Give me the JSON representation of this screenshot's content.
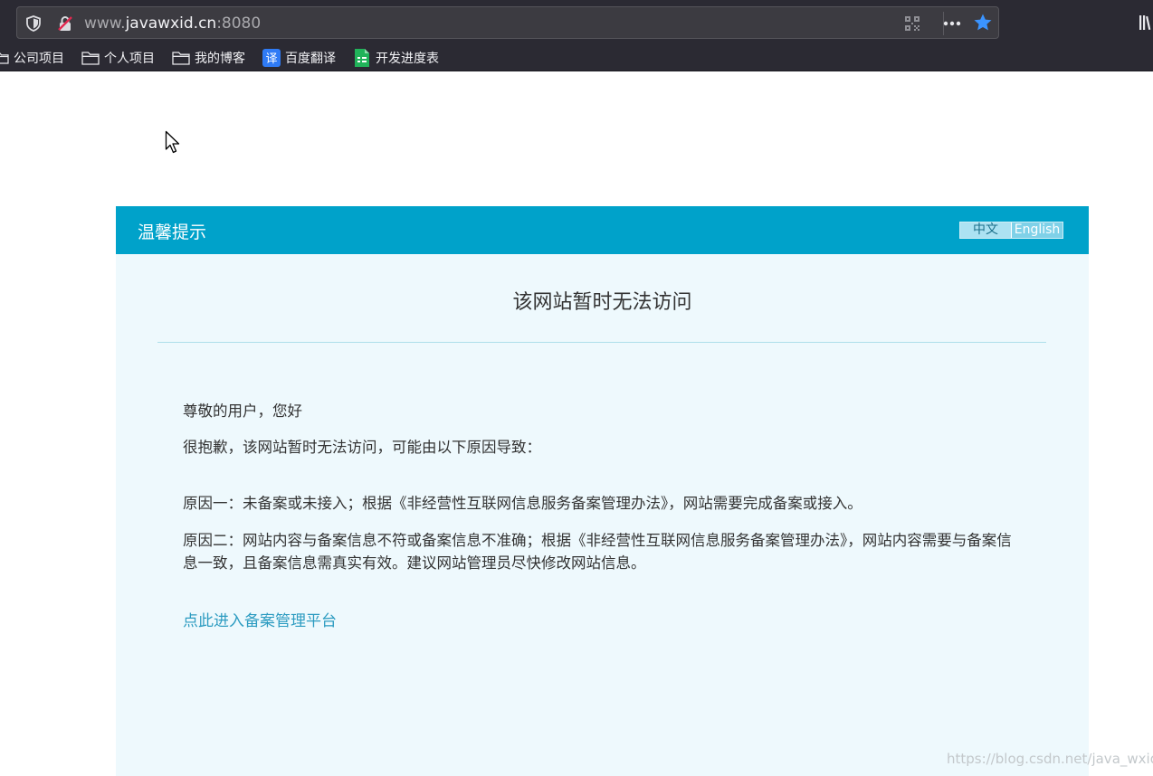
{
  "browser": {
    "url_prefix": "www.",
    "url_domain": "javawxid.cn",
    "url_port": ":8080",
    "icons": [
      "shield-icon",
      "insecure-lock-icon",
      "qr-code-icon",
      "page-actions-icon",
      "bookmark-star-icon",
      "library-icon"
    ],
    "colors": {
      "star": "#3b94ff",
      "toolbar": "#2b2a33"
    }
  },
  "bookmarks": [
    {
      "label": "公司项目",
      "icon": "folder-icon"
    },
    {
      "label": "个人项目",
      "icon": "folder-icon"
    },
    {
      "label": "我的博客",
      "icon": "folder-icon"
    },
    {
      "label": "百度翻译",
      "icon": "baidu-translate-icon",
      "icon_text": "译"
    },
    {
      "label": "开发进度表",
      "icon": "spreadsheet-icon"
    }
  ],
  "notice": {
    "header_title": "温馨提示",
    "lang_zh": "中文",
    "lang_en": "English",
    "title": "该网站暂时无法访问",
    "greeting": "尊敬的用户，您好",
    "intro": "很抱歉，该网站暂时无法访问，可能由以下原因导致：",
    "reason1": "原因一：未备案或未接入；根据《非经营性互联网信息服务备案管理办法》，网站需要完成备案或接入。",
    "reason2": "原因二：网站内容与备案信息不符或备案信息不准确；根据《非经营性互联网信息服务备案管理办法》，网站内容需要与备案信息一致，且备案信息需真实有效。建议网站管理员尽快修改网站信息。",
    "link_text": "点此进入备案管理平台",
    "colors": {
      "header": "#00a2ca",
      "body": "#eef9fd",
      "link": "#2d9cc1"
    }
  },
  "watermark": "https://blog.csdn.net/java_wxid"
}
